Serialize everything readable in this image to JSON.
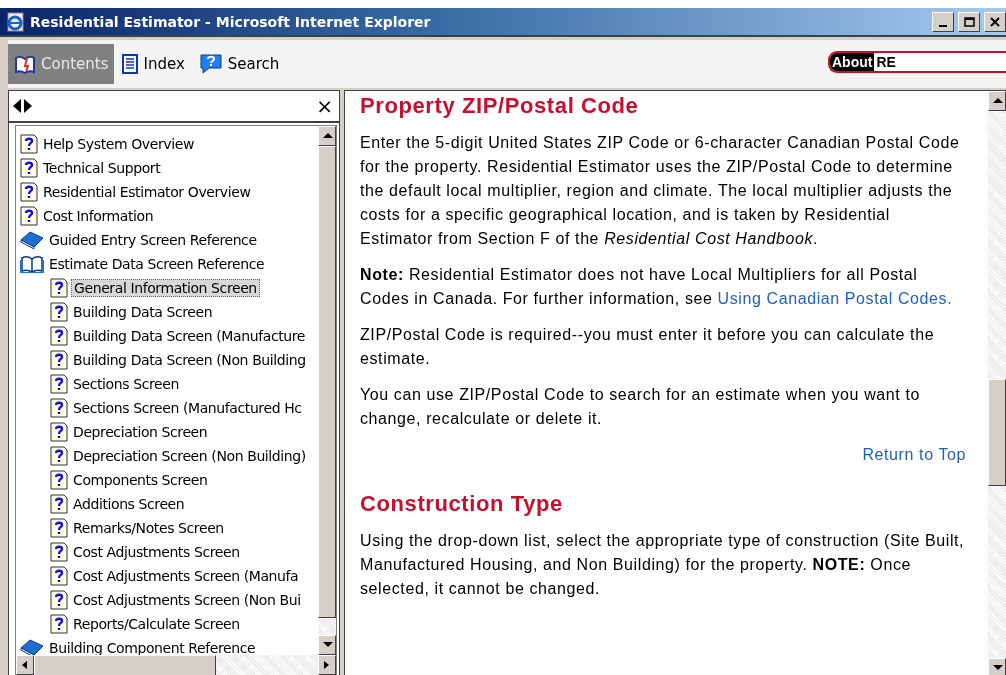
{
  "window": {
    "title": "Residential Estimator - Microsoft Internet Explorer"
  },
  "tabs": [
    {
      "label": "Contents",
      "kind": "contents",
      "selected": true
    },
    {
      "label": "Index",
      "kind": "index",
      "selected": false
    },
    {
      "label": "Search",
      "kind": "search",
      "selected": false
    }
  ],
  "about": {
    "label": "About",
    "value": "RE"
  },
  "nav": {
    "close": "×"
  },
  "tree": [
    {
      "label": "Help System Overview",
      "kind": "topic",
      "selected": false
    },
    {
      "label": "Technical Support",
      "kind": "topic",
      "selected": false
    },
    {
      "label": "Residential Estimator Overview",
      "kind": "topic",
      "selected": false
    },
    {
      "label": "Cost Information",
      "kind": "topic",
      "selected": false
    },
    {
      "label": "Guided Entry Screen Reference",
      "kind": "book",
      "expanded": false,
      "selected": false
    },
    {
      "label": "Estimate Data Screen Reference",
      "kind": "book",
      "expanded": true,
      "selected": false,
      "children": [
        {
          "label": "General Information Screen",
          "kind": "topic",
          "selected": true
        },
        {
          "label": "Building Data Screen",
          "kind": "topic",
          "selected": false
        },
        {
          "label": "Building Data Screen (Manufacture",
          "kind": "topic",
          "selected": false
        },
        {
          "label": "Building Data Screen (Non Building",
          "kind": "topic",
          "selected": false
        },
        {
          "label": "Sections Screen",
          "kind": "topic",
          "selected": false
        },
        {
          "label": "Sections Screen (Manufactured Hc",
          "kind": "topic",
          "selected": false
        },
        {
          "label": "Depreciation Screen",
          "kind": "topic",
          "selected": false
        },
        {
          "label": "Depreciation Screen (Non Building)",
          "kind": "topic",
          "selected": false
        },
        {
          "label": "Components Screen",
          "kind": "topic",
          "selected": false
        },
        {
          "label": "Additions Screen",
          "kind": "topic",
          "selected": false
        },
        {
          "label": "Remarks/Notes Screen",
          "kind": "topic",
          "selected": false
        },
        {
          "label": "Cost Adjustments Screen",
          "kind": "topic",
          "selected": false
        },
        {
          "label": "Cost Adjustments Screen (Manufa",
          "kind": "topic",
          "selected": false
        },
        {
          "label": "Cost Adjustments Screen (Non Bui",
          "kind": "topic",
          "selected": false
        },
        {
          "label": "Reports/Calculate Screen",
          "kind": "topic",
          "selected": false
        }
      ]
    },
    {
      "label": "Building Component Reference",
      "kind": "book",
      "expanded": false,
      "selected": false
    }
  ],
  "content": [
    {
      "kind": "heading",
      "text": "Property ZIP/Postal Code"
    },
    {
      "kind": "paragraph",
      "parts": [
        {
          "kind": "text",
          "text": "Enter the 5-digit United States ZIP Code or 6-character Canadian Postal Code for the property.  Residential Estimator uses the ZIP/Postal Code to determine the default local multiplier, region and climate. The local multiplier adjusts the costs for a specific geographical location, and is taken by Residential Estimator from Section F of the *Residential Cost Handbook*."
        }
      ]
    },
    {
      "kind": "paragraph",
      "parts": [
        {
          "kind": "text",
          "text": "**Note:**  Residential Estimator does not have Local Multipliers for all Postal Codes in Canada.  For further information, see "
        },
        {
          "kind": "link",
          "text": "Using Canadian Postal Codes."
        }
      ]
    },
    {
      "kind": "paragraph",
      "parts": [
        {
          "kind": "text",
          "text": "ZIP/Postal Code is required--you must enter it before you can calculate the estimate."
        }
      ]
    },
    {
      "kind": "paragraph",
      "parts": [
        {
          "kind": "text",
          "text": "You can use ZIP/Postal Code to search for an estimate when you want to change, recalculate or delete it."
        }
      ]
    },
    {
      "kind": "toplink",
      "text": "Return to Top"
    },
    {
      "kind": "heading",
      "text": "Construction Type"
    },
    {
      "kind": "paragraph",
      "parts": [
        {
          "kind": "text",
          "text": "Using the drop-down list, select the appropriate type of construction (Site Built, Manufactured Housing, and Non Building) for the property.  **NOTE:**  Once selected, it cannot be changed."
        }
      ]
    }
  ]
}
